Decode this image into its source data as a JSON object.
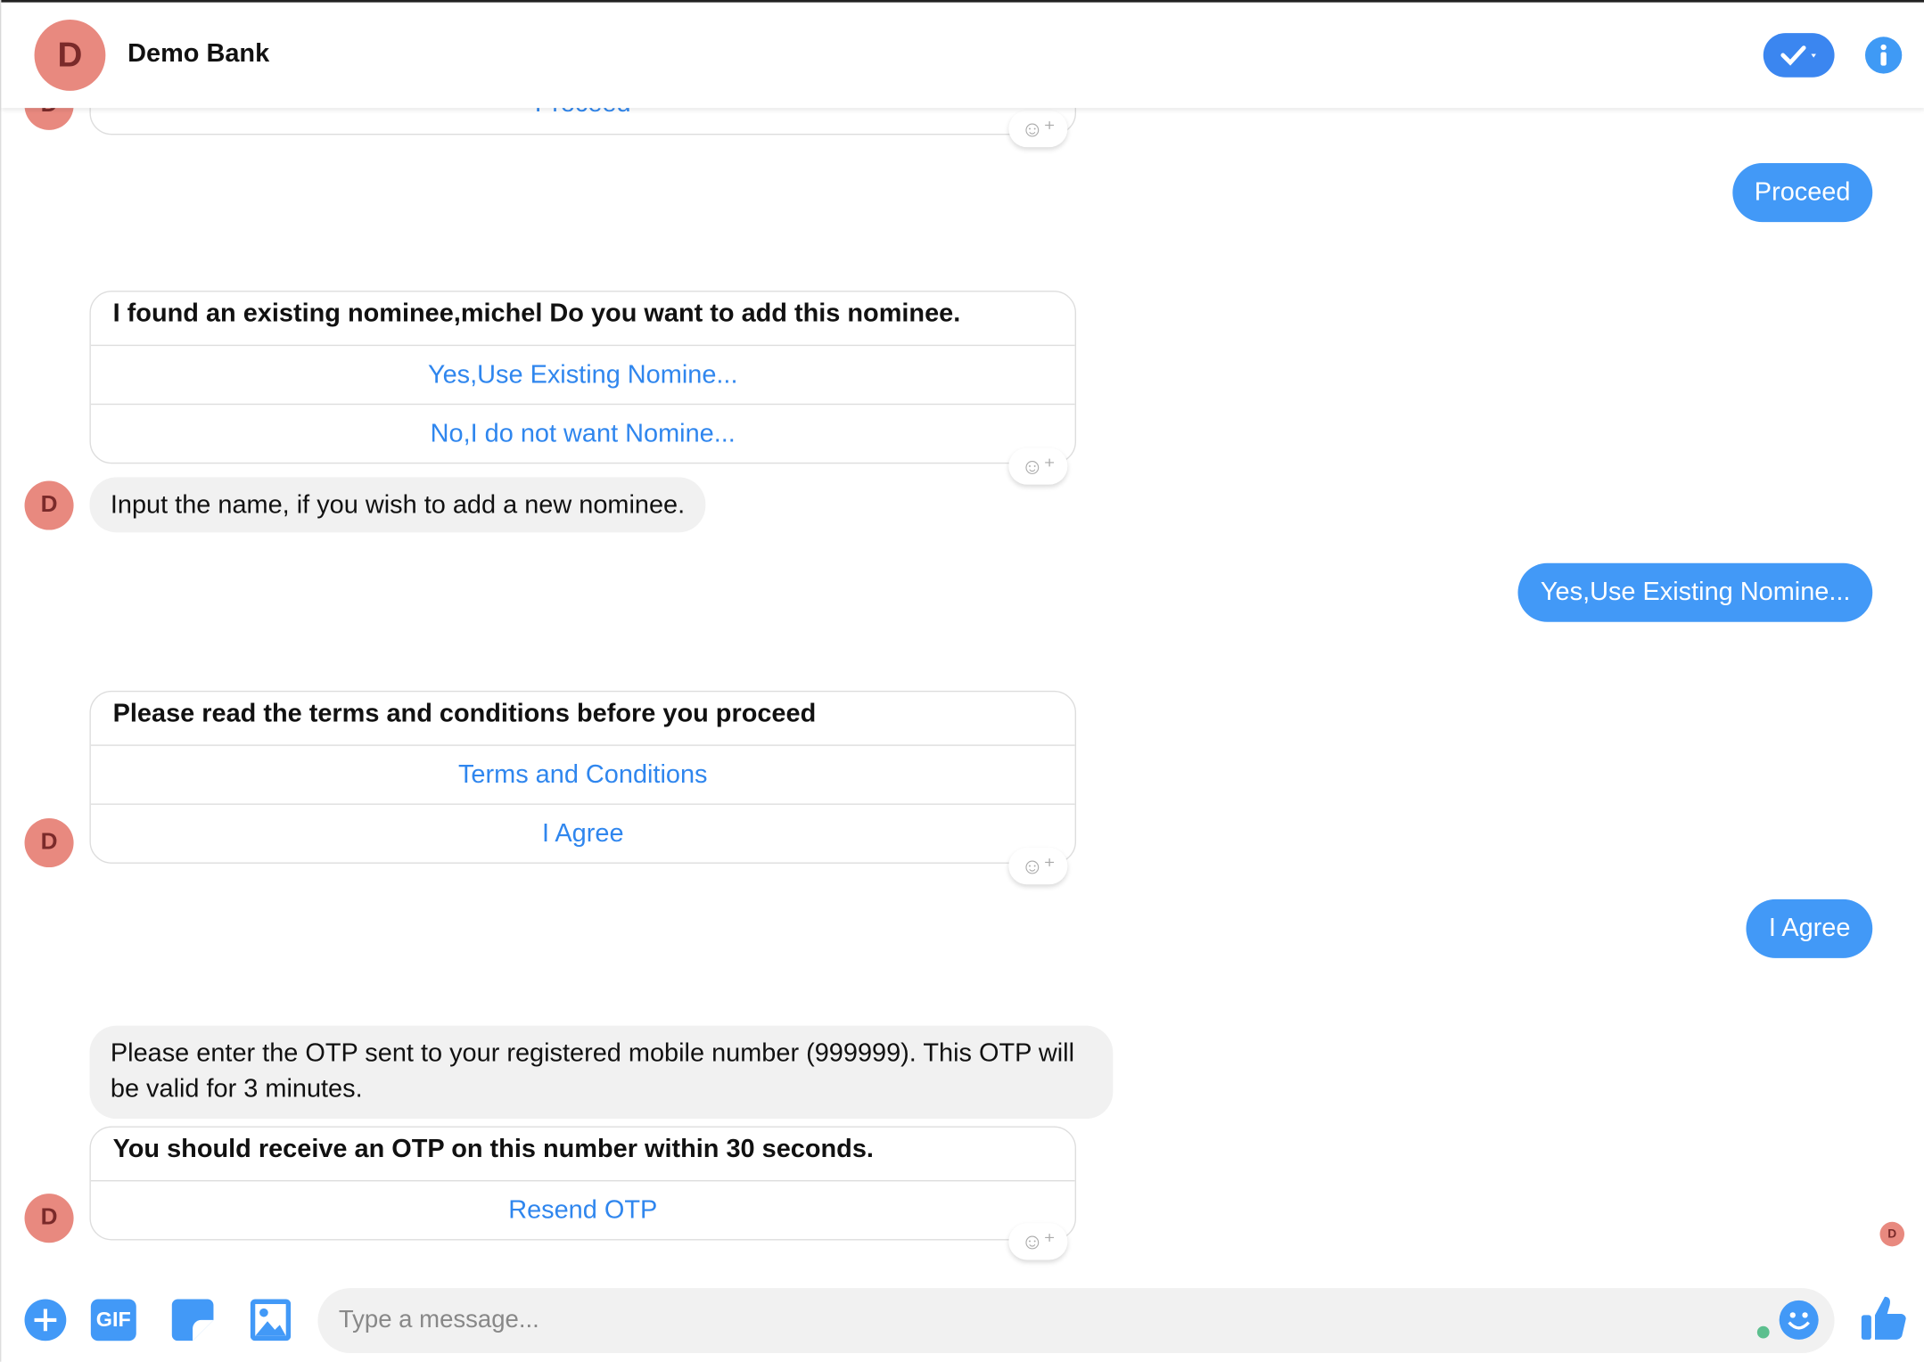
{
  "header": {
    "avatar_letter": "D",
    "title": "Demo Bank",
    "icons": [
      "check-dropdown-icon",
      "info-icon"
    ]
  },
  "colors": {
    "accent": "#4299f7",
    "avatar": "#e8897f",
    "bubble_grey": "#f1f1f1"
  },
  "messages": {
    "card0": {
      "button": "Proceed"
    },
    "reply1": "Proceed",
    "card1": {
      "title": "I found an existing nominee,michel Do you want to add this nominee.",
      "buttons": [
        "Yes,Use Existing Nomine...",
        "No,I do not want Nomine..."
      ]
    },
    "text1": "Input the name, if you wish to add a new nominee.",
    "reply2": "Yes,Use Existing Nomine...",
    "card2": {
      "title": "Please read the terms and conditions before you proceed",
      "buttons": [
        "Terms and Conditions",
        "I Agree"
      ]
    },
    "reply3": "I Agree",
    "text2": "Please enter the OTP sent to your registered mobile number (999999). This OTP will be valid for 3 minutes.",
    "card3": {
      "title": "You should receive an OTP on this number within 30 seconds.",
      "buttons": [
        "Resend OTP"
      ]
    },
    "avatar_letter": "D"
  },
  "composer": {
    "placeholder": "Type a message...",
    "gif_label": "GIF",
    "icons": [
      "plus-icon",
      "gif-icon",
      "sticker-icon",
      "image-icon",
      "emoji-icon",
      "thumbs-up-icon"
    ]
  }
}
